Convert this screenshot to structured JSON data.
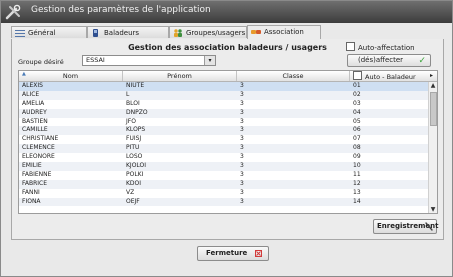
{
  "window": {
    "title": "Gestion des paramètres de l'application"
  },
  "tabs": [
    {
      "label": "Général",
      "icon": "list-icon"
    },
    {
      "label": "Baladeurs",
      "icon": "device-icon"
    },
    {
      "label": "Groupes/usagers",
      "icon": "users-icon"
    },
    {
      "label": "Association",
      "icon": "link-icon",
      "active": true
    }
  ],
  "association": {
    "heading": "Gestion des association baladeurs / usagers",
    "auto_affectation_label": "Auto-affectation",
    "group_label": "Groupe désiré",
    "group_value": "ESSAI",
    "desaffecter_label": "(dés)affecter",
    "columns": {
      "nom": "Nom",
      "prenom": "Prénom",
      "classe": "Classe",
      "auto": "Auto - Baladeur"
    },
    "rows": [
      {
        "nom": "ALEXIS",
        "prenom": "NIUTE",
        "classe": "3",
        "auto": "01"
      },
      {
        "nom": "ALICE",
        "prenom": "L",
        "classe": "3",
        "auto": "02"
      },
      {
        "nom": "AMELIA",
        "prenom": "BLOI",
        "classe": "3",
        "auto": "03"
      },
      {
        "nom": "AUDREY",
        "prenom": "DNPZO",
        "classe": "3",
        "auto": "04"
      },
      {
        "nom": "BASTIEN",
        "prenom": "JFO",
        "classe": "3",
        "auto": "05"
      },
      {
        "nom": "CAMILLE",
        "prenom": "KLOPS",
        "classe": "3",
        "auto": "06"
      },
      {
        "nom": "CHRISTIANE",
        "prenom": "FUISJ",
        "classe": "3",
        "auto": "07"
      },
      {
        "nom": "CLEMENCE",
        "prenom": "PITU",
        "classe": "3",
        "auto": "08"
      },
      {
        "nom": "ELEONORE",
        "prenom": "LOSO",
        "classe": "3",
        "auto": "09"
      },
      {
        "nom": "EMILIE",
        "prenom": "KJOLOI",
        "classe": "3",
        "auto": "10"
      },
      {
        "nom": "FABIENNE",
        "prenom": "POLKI",
        "classe": "3",
        "auto": "11"
      },
      {
        "nom": "FABRICE",
        "prenom": "KDOI",
        "classe": "3",
        "auto": "12"
      },
      {
        "nom": "FANNI",
        "prenom": "VZ",
        "classe": "3",
        "auto": "13"
      },
      {
        "nom": "FIONA",
        "prenom": "OEJF",
        "classe": "3",
        "auto": "14"
      }
    ],
    "save_label": "Enregistrement"
  },
  "footer": {
    "close_label": "Fermeture"
  },
  "colors": {
    "selected_row": "#cfdff2",
    "alt_row": "#eef1f6",
    "check_green": "#3aa43a",
    "close_red": "#d23a3a"
  }
}
